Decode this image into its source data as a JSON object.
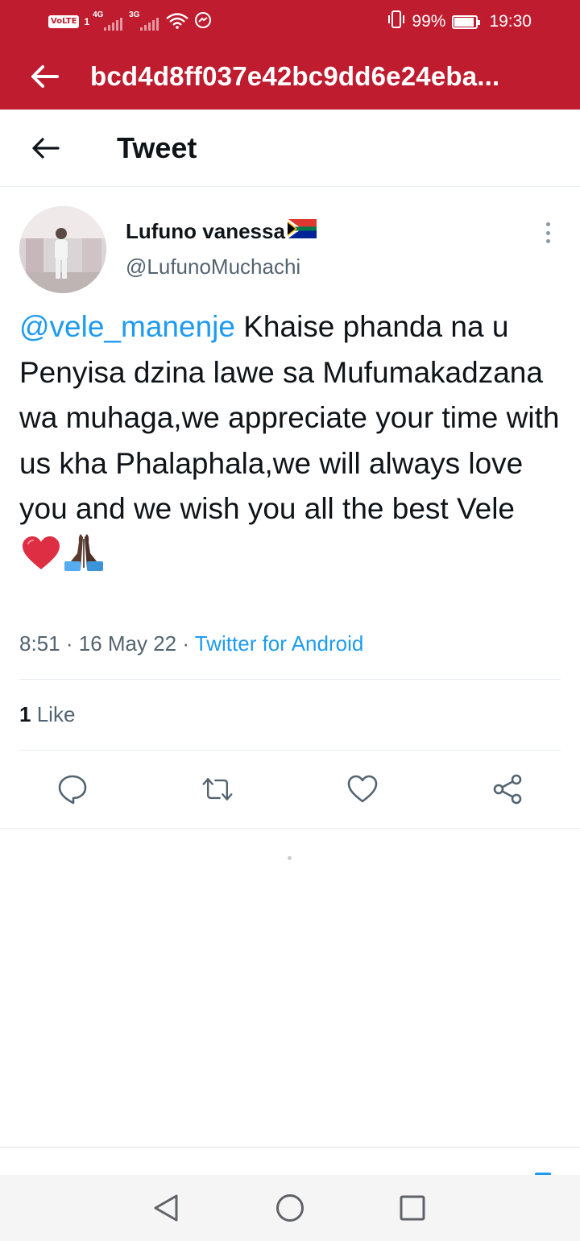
{
  "status_bar": {
    "volte": "VoLTE",
    "sim1": "1",
    "network_1": "4G",
    "network_2": "3G",
    "battery_percent": "99%",
    "time": "19:30"
  },
  "browser": {
    "title": "bcd4d8ff037e42bc9dd6e24eba..."
  },
  "header": {
    "title": "Tweet"
  },
  "tweet": {
    "user": {
      "name": "Lufuno vanessa",
      "handle": "@LufunoMuchachi"
    },
    "mention": "@vele_manenje",
    "body": " Khaise phanda na u Penyisa dzina lawe sa Mufumakadzana wa muhaga,we appreciate your time with us kha Phalaphala,we will always love you and we wish you all the best Vele ",
    "emojis": [
      "red-heart",
      "folded-hands"
    ],
    "time": "8:51",
    "date": "16 May 22",
    "source": "Twitter for Android",
    "likes_count": "1",
    "likes_label": "Like"
  },
  "colors": {
    "browser_bar": "#c01c2f",
    "link": "#1d9bf0",
    "secondary_text": "#536471"
  },
  "icons": {
    "actions": [
      "reply-icon",
      "retweet-icon",
      "like-icon",
      "share-icon"
    ],
    "nav": [
      "nav-back-icon",
      "nav-home-icon",
      "nav-recents-icon"
    ]
  }
}
